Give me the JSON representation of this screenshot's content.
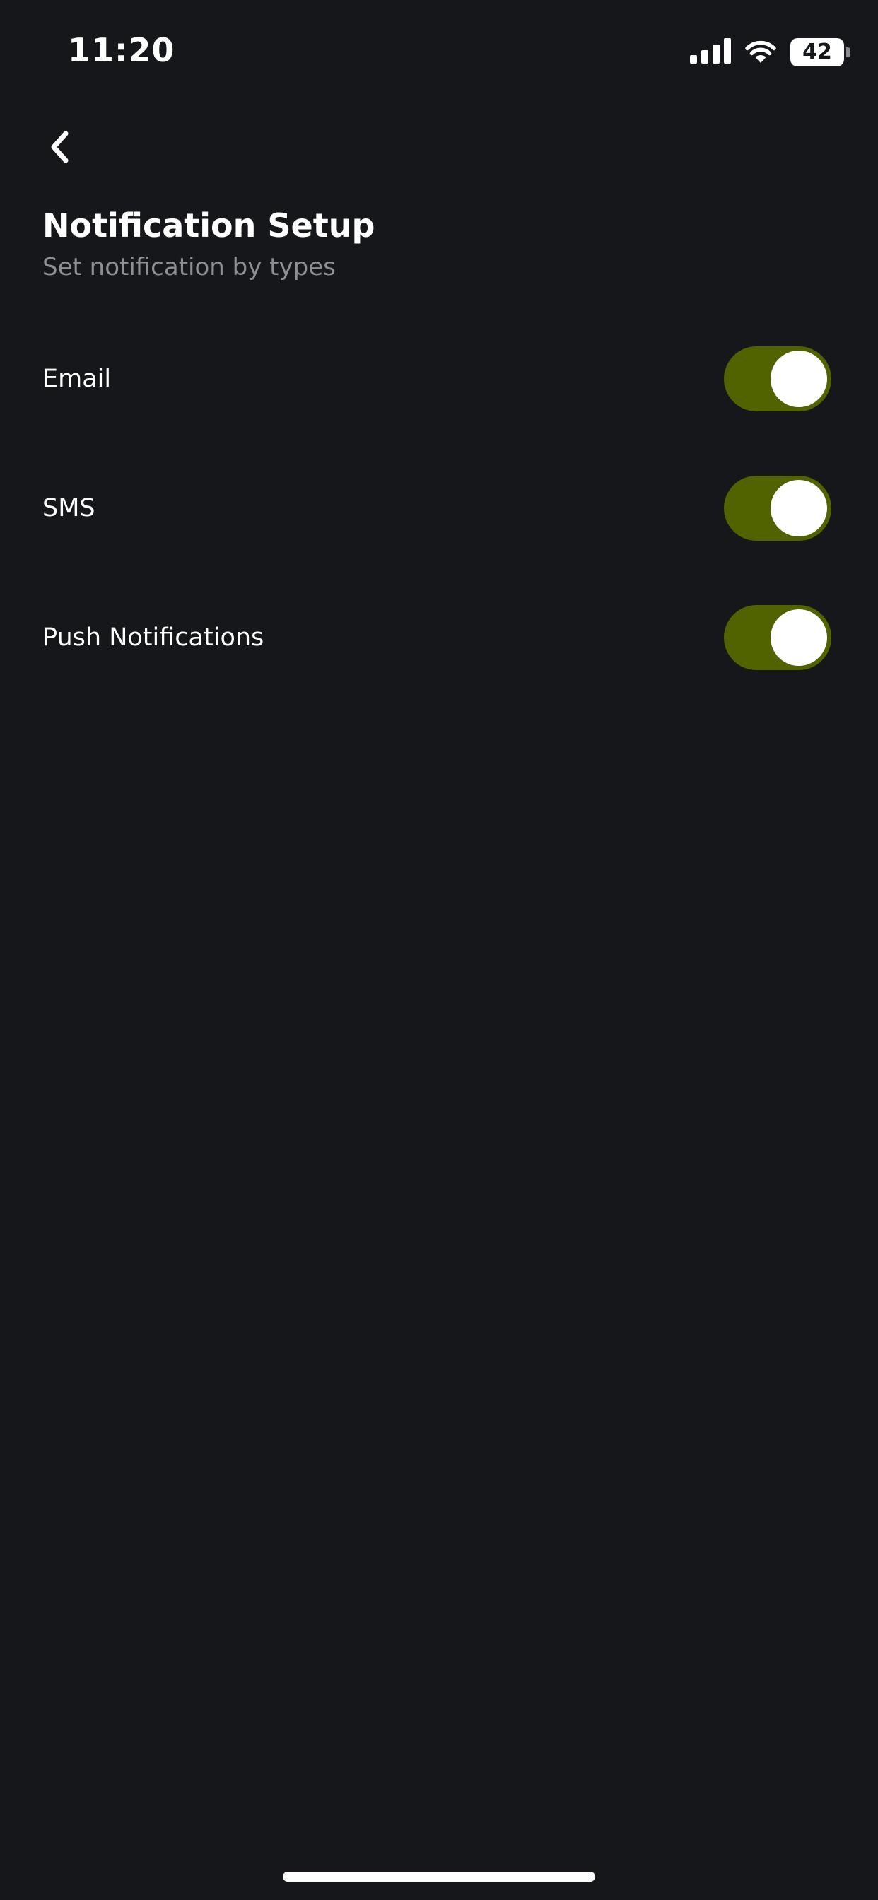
{
  "status_bar": {
    "time": "11:20",
    "battery_level": "42",
    "icons": [
      "signal-icon",
      "wifi-icon",
      "battery-icon"
    ]
  },
  "header": {
    "back_icon": "chevron-left-icon",
    "title": "Notification Setup",
    "subtitle": "Set notification by types"
  },
  "settings": [
    {
      "label": "Email",
      "enabled": true
    },
    {
      "label": "SMS",
      "enabled": true
    },
    {
      "label": "Push Notifications",
      "enabled": true
    }
  ],
  "colors": {
    "background": "#16171a",
    "toggle_on": "#516200",
    "subtitle": "#8e8f93"
  }
}
